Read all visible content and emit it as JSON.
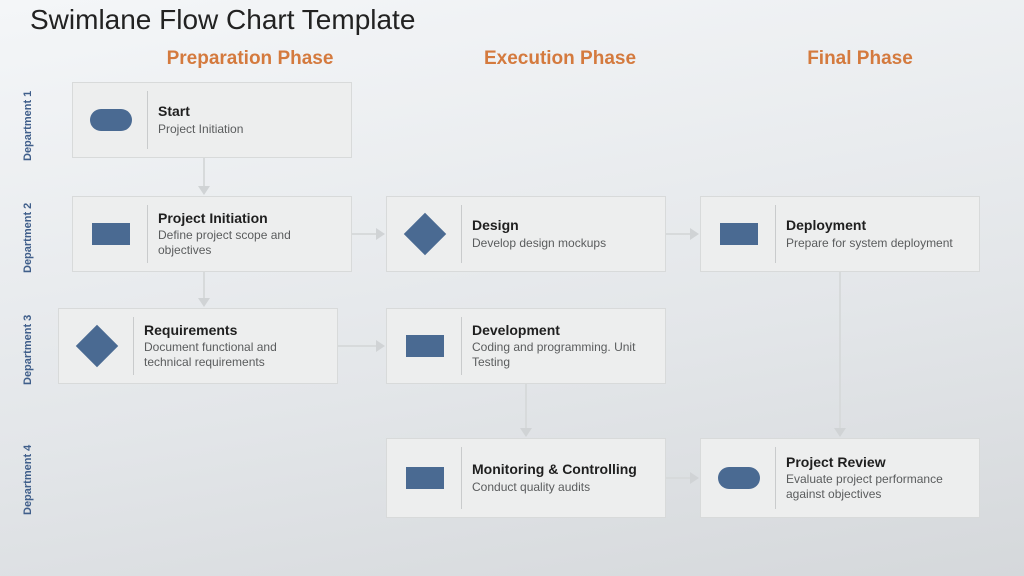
{
  "title": "Swimlane Flow Chart Template",
  "phases": {
    "preparation": "Preparation Phase",
    "execution": "Execution Phase",
    "final": "Final Phase"
  },
  "lanes": {
    "d1": "Department 1",
    "d2": "Department 2",
    "d3": "Department 3",
    "d4": "Department 4"
  },
  "cards": {
    "start": {
      "title": "Start",
      "desc": "Project Initiation"
    },
    "initiation": {
      "title": "Project Initiation",
      "desc": "Define project scope and objectives"
    },
    "requirements": {
      "title": "Requirements",
      "desc": "Document functional and technical requirements"
    },
    "design": {
      "title": "Design",
      "desc": "Develop design mockups"
    },
    "development": {
      "title": "Development",
      "desc": "Coding and programming. Unit Testing"
    },
    "monitoring": {
      "title": "Monitoring & Controlling",
      "desc": "Conduct quality audits"
    },
    "deployment": {
      "title": "Deployment",
      "desc": "Prepare for system deployment"
    },
    "review": {
      "title": "Project Review",
      "desc": "Evaluate project performance against objectives"
    }
  },
  "colors": {
    "phase_header": "#d47a3e",
    "shape_fill": "#4a6a92",
    "lane_label": "#3f5e8a"
  }
}
